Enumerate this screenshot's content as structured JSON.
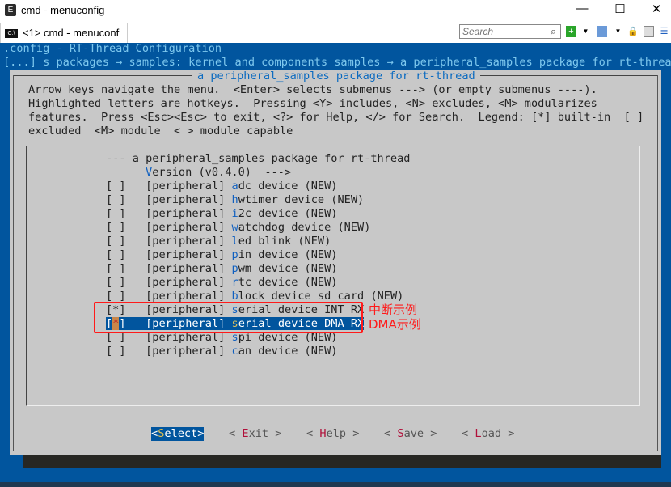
{
  "window": {
    "title": "cmd - menuconfig",
    "icon": "console-app-icon",
    "controls": [
      "minimize",
      "maximize",
      "close"
    ]
  },
  "tabbar": {
    "tab_label": "<1> cmd - menuconf",
    "search_placeholder": "Search"
  },
  "console": {
    "header": ".config - RT-Thread Configuration",
    "breadcrumb": "[...] s packages → samples: kernel and components samples → a peripheral_samples package for rt-thread",
    "dialog_title": "a peripheral_samples package for rt-thread",
    "help": [
      "Arrow keys navigate the menu.  <Enter> selects submenus ---> (or empty submenus ----).",
      "Highlighted letters are hotkeys.  Pressing <Y> includes, <N> excludes, <M> modularizes",
      "features.  Press <Esc><Esc> to exit, <?> for Help, </> for Search.  Legend: [*] built-in  [ ]",
      "excluded  <M> module  < > module capable"
    ],
    "menu_header": "--- a peripheral_samples package for rt-thread",
    "version": {
      "hk": "V",
      "rest": "ersion (v0.4.0)  --->"
    },
    "items": [
      {
        "box": "[ ]",
        "tag": "[peripheral] ",
        "hk": "a",
        "rest": "dc device (NEW)"
      },
      {
        "box": "[ ]",
        "tag": "[peripheral] ",
        "hk": "h",
        "rest": "wtimer device (NEW)"
      },
      {
        "box": "[ ]",
        "tag": "[peripheral] ",
        "hk": "i",
        "rest": "2c device (NEW)"
      },
      {
        "box": "[ ]",
        "tag": "[peripheral] ",
        "hk": "w",
        "rest": "atchdog device (NEW)"
      },
      {
        "box": "[ ]",
        "tag": "[peripheral] ",
        "hk": "l",
        "rest": "ed blink (NEW)"
      },
      {
        "box": "[ ]",
        "tag": "[peripheral] ",
        "hk": "p",
        "rest": "in device (NEW)"
      },
      {
        "box": "[ ]",
        "tag": "[peripheral] ",
        "hk": "p",
        "rest": "wm device (NEW)"
      },
      {
        "box": "[ ]",
        "tag": "[peripheral] ",
        "hk": "r",
        "rest": "tc device (NEW)"
      },
      {
        "box": "[ ]",
        "tag": "[peripheral] ",
        "hk": "b",
        "rest": "lock device sd card (NEW)"
      },
      {
        "box": "[*]",
        "tag": "[peripheral] ",
        "hk": "s",
        "rest": "erial device INT RX"
      },
      {
        "box": "[*]",
        "tag": "[peripheral] ",
        "hk": "s",
        "rest": "erial device DMA RX",
        "selected": true
      },
      {
        "box": "[ ]",
        "tag": "[peripheral] ",
        "hk": "s",
        "rest": "pi device (NEW)"
      },
      {
        "box": "[ ]",
        "tag": "[peripheral] ",
        "hk": "c",
        "rest": "an device (NEW)"
      }
    ],
    "buttons": [
      {
        "l": "<",
        "hk": "S",
        "rest": "elect",
        "r": ">",
        "active": true
      },
      {
        "l": "< ",
        "hk": "E",
        "rest": "xit",
        "r": " >"
      },
      {
        "l": "< ",
        "hk": "H",
        "rest": "elp",
        "r": " >"
      },
      {
        "l": "< ",
        "hk": "S",
        "rest": "ave",
        "r": " >"
      },
      {
        "l": "< ",
        "hk": "L",
        "rest": "oad",
        "r": " >"
      }
    ]
  },
  "annotations": {
    "int_note": "中断示例",
    "dma_note": "DMA示例",
    "color": "#ff1a1a"
  },
  "colors": {
    "console_bg": "#01559e",
    "dialog_bg": "#c8c8c8",
    "hotkey": "#1060c0",
    "button_hotkey": "#b0103a"
  }
}
